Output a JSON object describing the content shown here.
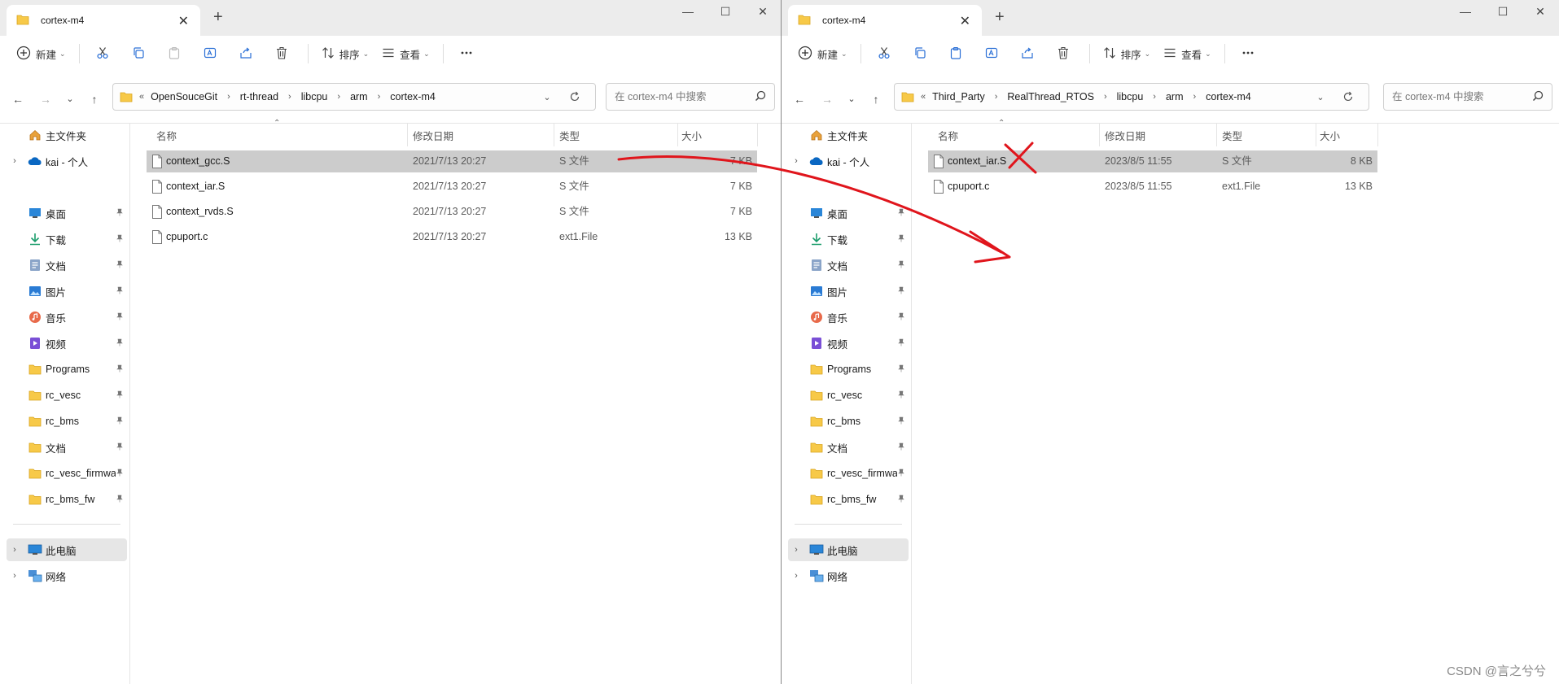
{
  "left": {
    "tab_title": "cortex-m4",
    "toolbar": {
      "new_label": "新建",
      "sort_label": "排序",
      "view_label": "查看"
    },
    "breadcrumb": [
      "OpenSouceGit",
      "rt-thread",
      "libcpu",
      "arm",
      "cortex-m4"
    ],
    "search_placeholder": "在 cortex-m4 中搜索",
    "sidebar": {
      "home": "主文件夹",
      "cloud": "kai - 个人",
      "pinned": [
        "桌面",
        "下载",
        "文档",
        "图片",
        "音乐",
        "视频",
        "Programs",
        "rc_vesc",
        "rc_bms",
        "文档",
        "rc_vesc_firmwa",
        "rc_bms_fw"
      ],
      "pc": "此电脑",
      "network": "网络"
    },
    "columns": {
      "name": "名称",
      "date": "修改日期",
      "type": "类型",
      "size": "大小"
    },
    "files": [
      {
        "name": "context_gcc.S",
        "date": "2021/7/13 20:27",
        "type": "S 文件",
        "size": "7 KB"
      },
      {
        "name": "context_iar.S",
        "date": "2021/7/13 20:27",
        "type": "S 文件",
        "size": "7 KB"
      },
      {
        "name": "context_rvds.S",
        "date": "2021/7/13 20:27",
        "type": "S 文件",
        "size": "7 KB"
      },
      {
        "name": "cpuport.c",
        "date": "2021/7/13 20:27",
        "type": "ext1.File",
        "size": "13 KB"
      }
    ]
  },
  "right": {
    "tab_title": "cortex-m4",
    "toolbar": {
      "new_label": "新建",
      "sort_label": "排序",
      "view_label": "查看"
    },
    "breadcrumb": [
      "Third_Party",
      "RealThread_RTOS",
      "libcpu",
      "arm",
      "cortex-m4"
    ],
    "search_placeholder": "在 cortex-m4 中搜索",
    "sidebar": {
      "home": "主文件夹",
      "cloud": "kai - 个人",
      "pinned": [
        "桌面",
        "下载",
        "文档",
        "图片",
        "音乐",
        "视频",
        "Programs",
        "rc_vesc",
        "rc_bms",
        "文档",
        "rc_vesc_firmwa",
        "rc_bms_fw"
      ],
      "pc": "此电脑",
      "network": "网络"
    },
    "columns": {
      "name": "名称",
      "date": "修改日期",
      "type": "类型",
      "size": "大小"
    },
    "files": [
      {
        "name": "context_iar.S",
        "date": "2023/8/5 11:55",
        "type": "S 文件",
        "size": "8 KB"
      },
      {
        "name": "cpuport.c",
        "date": "2023/8/5 11:55",
        "type": "ext1.File",
        "size": "13 KB"
      }
    ]
  },
  "pinned_icons": [
    "desktop-icon",
    "download-icon",
    "documents-icon",
    "pictures-icon",
    "music-icon",
    "videos-icon",
    "folder-icon",
    "folder-icon",
    "folder-icon",
    "folder-icon",
    "folder-icon",
    "folder-icon"
  ],
  "selected_file_left": "context_gcc.S",
  "selected_file_right": "context_iar.S",
  "annotation_color": "#e0151c",
  "watermark": "CSDN @言之兮兮"
}
